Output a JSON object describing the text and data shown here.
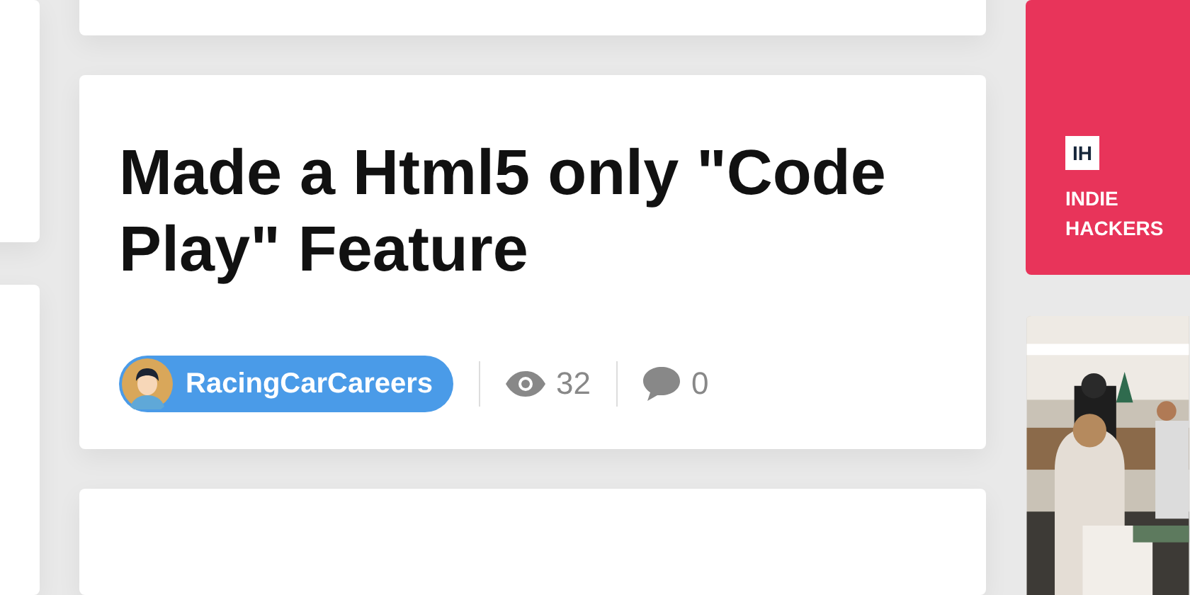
{
  "post": {
    "title": "Made a Html5 only \"Code Play\" Feature",
    "author": "RacingCarCareers",
    "views": "32",
    "comments": "0"
  },
  "sponsor": {
    "logo": "IH",
    "name": "INDIE HACKERS"
  }
}
